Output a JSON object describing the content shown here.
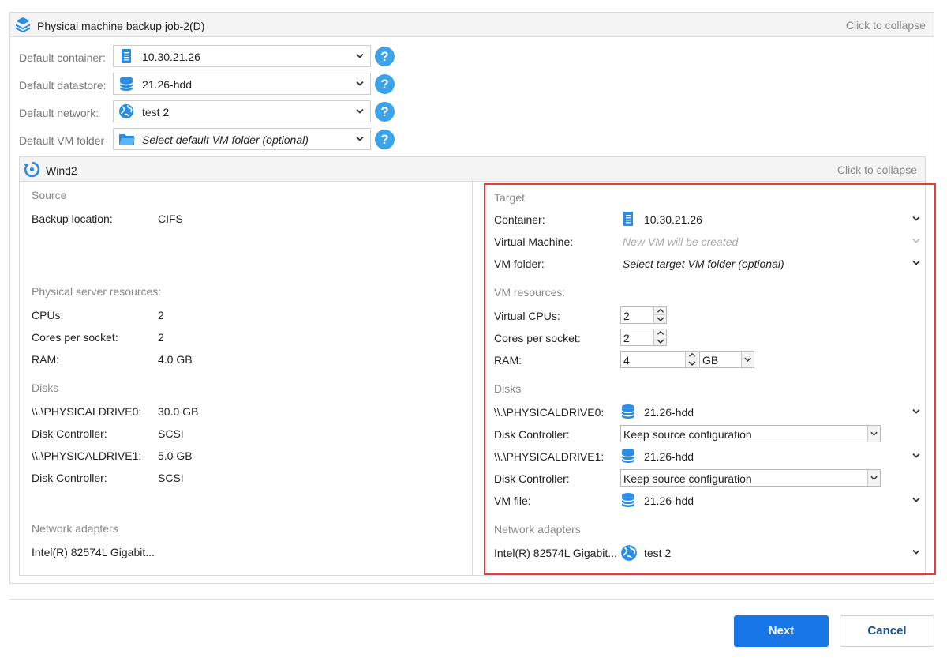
{
  "job": {
    "title": "Physical machine backup job-2(D)",
    "collapse_label": "Click to collapse",
    "defaults": [
      {
        "label": "Default container:",
        "value": "10.30.21.26",
        "icon": "server-icon",
        "italic": false
      },
      {
        "label": "Default datastore:",
        "value": "21.26-hdd",
        "icon": "database-icon",
        "italic": false
      },
      {
        "label": "Default network:",
        "value": "test 2",
        "icon": "globe-icon",
        "italic": false
      },
      {
        "label": "Default VM folder",
        "value": "Select default VM folder (optional)",
        "icon": "folder-icon",
        "italic": true
      }
    ],
    "help_glyph": "?"
  },
  "vm": {
    "title": "Wind2",
    "collapse_label": "Click to collapse",
    "source": {
      "section_title": "Source",
      "backup_location_label": "Backup location:",
      "backup_location_value": "CIFS",
      "resources_title": "Physical server resources:",
      "cpus_label": "CPUs:",
      "cpus_value": "2",
      "cores_label": "Cores per socket:",
      "cores_value": "2",
      "ram_label": "RAM:",
      "ram_value": "4.0 GB",
      "disks_title": "Disks",
      "disk0_label": "\\\\.\\PHYSICALDRIVE0:",
      "disk0_value": "30.0 GB",
      "ctrl0_label": "Disk Controller:",
      "ctrl0_value": "SCSI",
      "disk1_label": "\\\\.\\PHYSICALDRIVE1:",
      "disk1_value": "5.0 GB",
      "ctrl1_label": "Disk Controller:",
      "ctrl1_value": "SCSI",
      "network_title": "Network adapters",
      "adapter_label": "Intel(R) 82574L Gigabit..."
    },
    "target": {
      "section_title": "Target",
      "container_label": "Container:",
      "container_value": "10.30.21.26",
      "vm_label": "Virtual Machine:",
      "vm_value": "New VM will be created",
      "folder_label": "VM folder:",
      "folder_value": "Select target VM folder (optional)",
      "resources_title": "VM resources:",
      "vcpus_label": "Virtual CPUs:",
      "vcpus_value": "2",
      "cores_label": "Cores per socket:",
      "cores_value": "2",
      "ram_label": "RAM:",
      "ram_value": "4",
      "ram_unit": "GB",
      "disks_title": "Disks",
      "disk0_label": "\\\\.\\PHYSICALDRIVE0:",
      "disk0_value": "21.26-hdd",
      "ctrl0_label": "Disk Controller:",
      "ctrl0_value": "Keep source configuration",
      "disk1_label": "\\\\.\\PHYSICALDRIVE1:",
      "disk1_value": "21.26-hdd",
      "ctrl1_label": "Disk Controller:",
      "ctrl1_value": "Keep source configuration",
      "vmfile_label": "VM file:",
      "vmfile_value": "21.26-hdd",
      "network_title": "Network adapters",
      "adapter_label": "Intel(R) 82574L Gigabit...",
      "adapter_value": "test 2"
    }
  },
  "footer": {
    "next_label": "Next",
    "cancel_label": "Cancel"
  },
  "colors": {
    "accent": "#1877e8",
    "icon_blue": "#3aa3ea",
    "highlight_border": "#e53a3a"
  }
}
